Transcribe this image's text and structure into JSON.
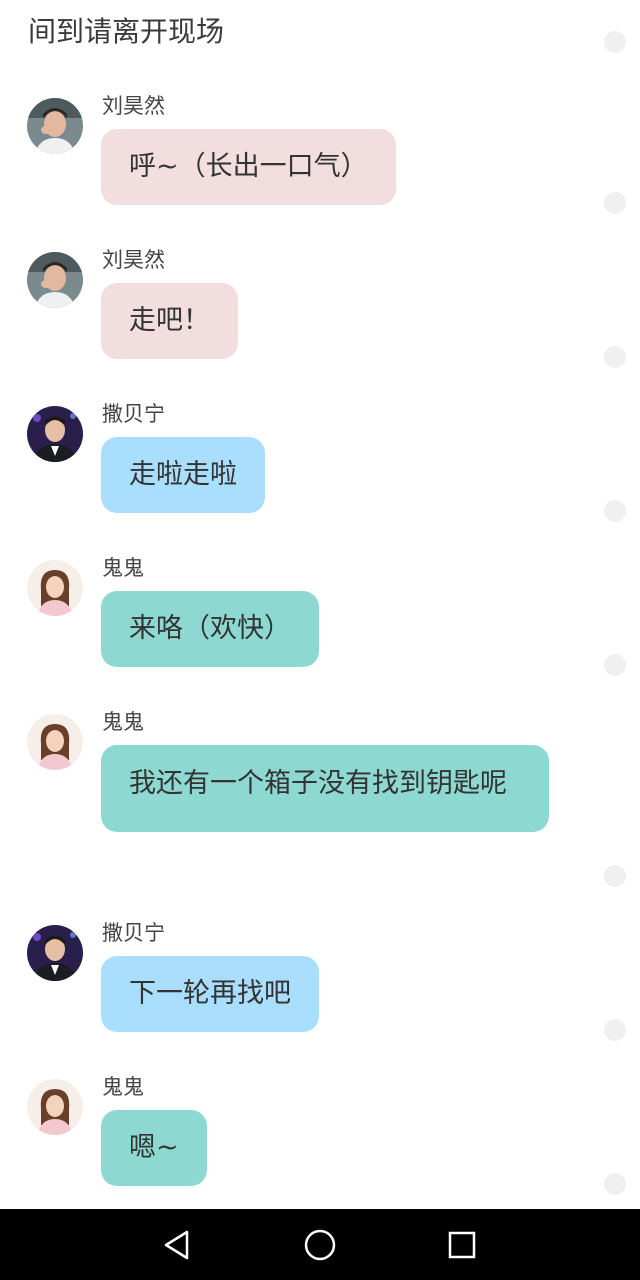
{
  "header": {
    "text": "间到请离开现场"
  },
  "messages": [
    {
      "sender": "刘昊然",
      "text": "呼~（长出一口气）",
      "color": "#f2dede",
      "avatar": "avatar-liu-haoran"
    },
    {
      "sender": "刘昊然",
      "text": "走吧！",
      "color": "#f2dede",
      "avatar": "avatar-liu-haoran"
    },
    {
      "sender": "撒贝宁",
      "text": "走啦走啦",
      "color": "#aadeff",
      "avatar": "avatar-sa-beining"
    },
    {
      "sender": "鬼鬼",
      "text": "来咯（欢快）",
      "color": "#8dd9d1",
      "avatar": "avatar-guigui"
    },
    {
      "sender": "鬼鬼",
      "text": "我还有一个箱子没有找到钥匙呢",
      "color": "#8dd9d1",
      "avatar": "avatar-guigui"
    },
    {
      "sender": "撒贝宁",
      "text": "下一轮再找吧",
      "color": "#aadeff",
      "avatar": "avatar-sa-beining"
    },
    {
      "sender": "鬼鬼",
      "text": "嗯~",
      "color": "#8dd9d1",
      "avatar": "avatar-guigui"
    }
  ],
  "navbar": {
    "back_icon": "back-triangle-icon",
    "home_icon": "home-circle-icon",
    "recents_icon": "recents-square-icon"
  }
}
